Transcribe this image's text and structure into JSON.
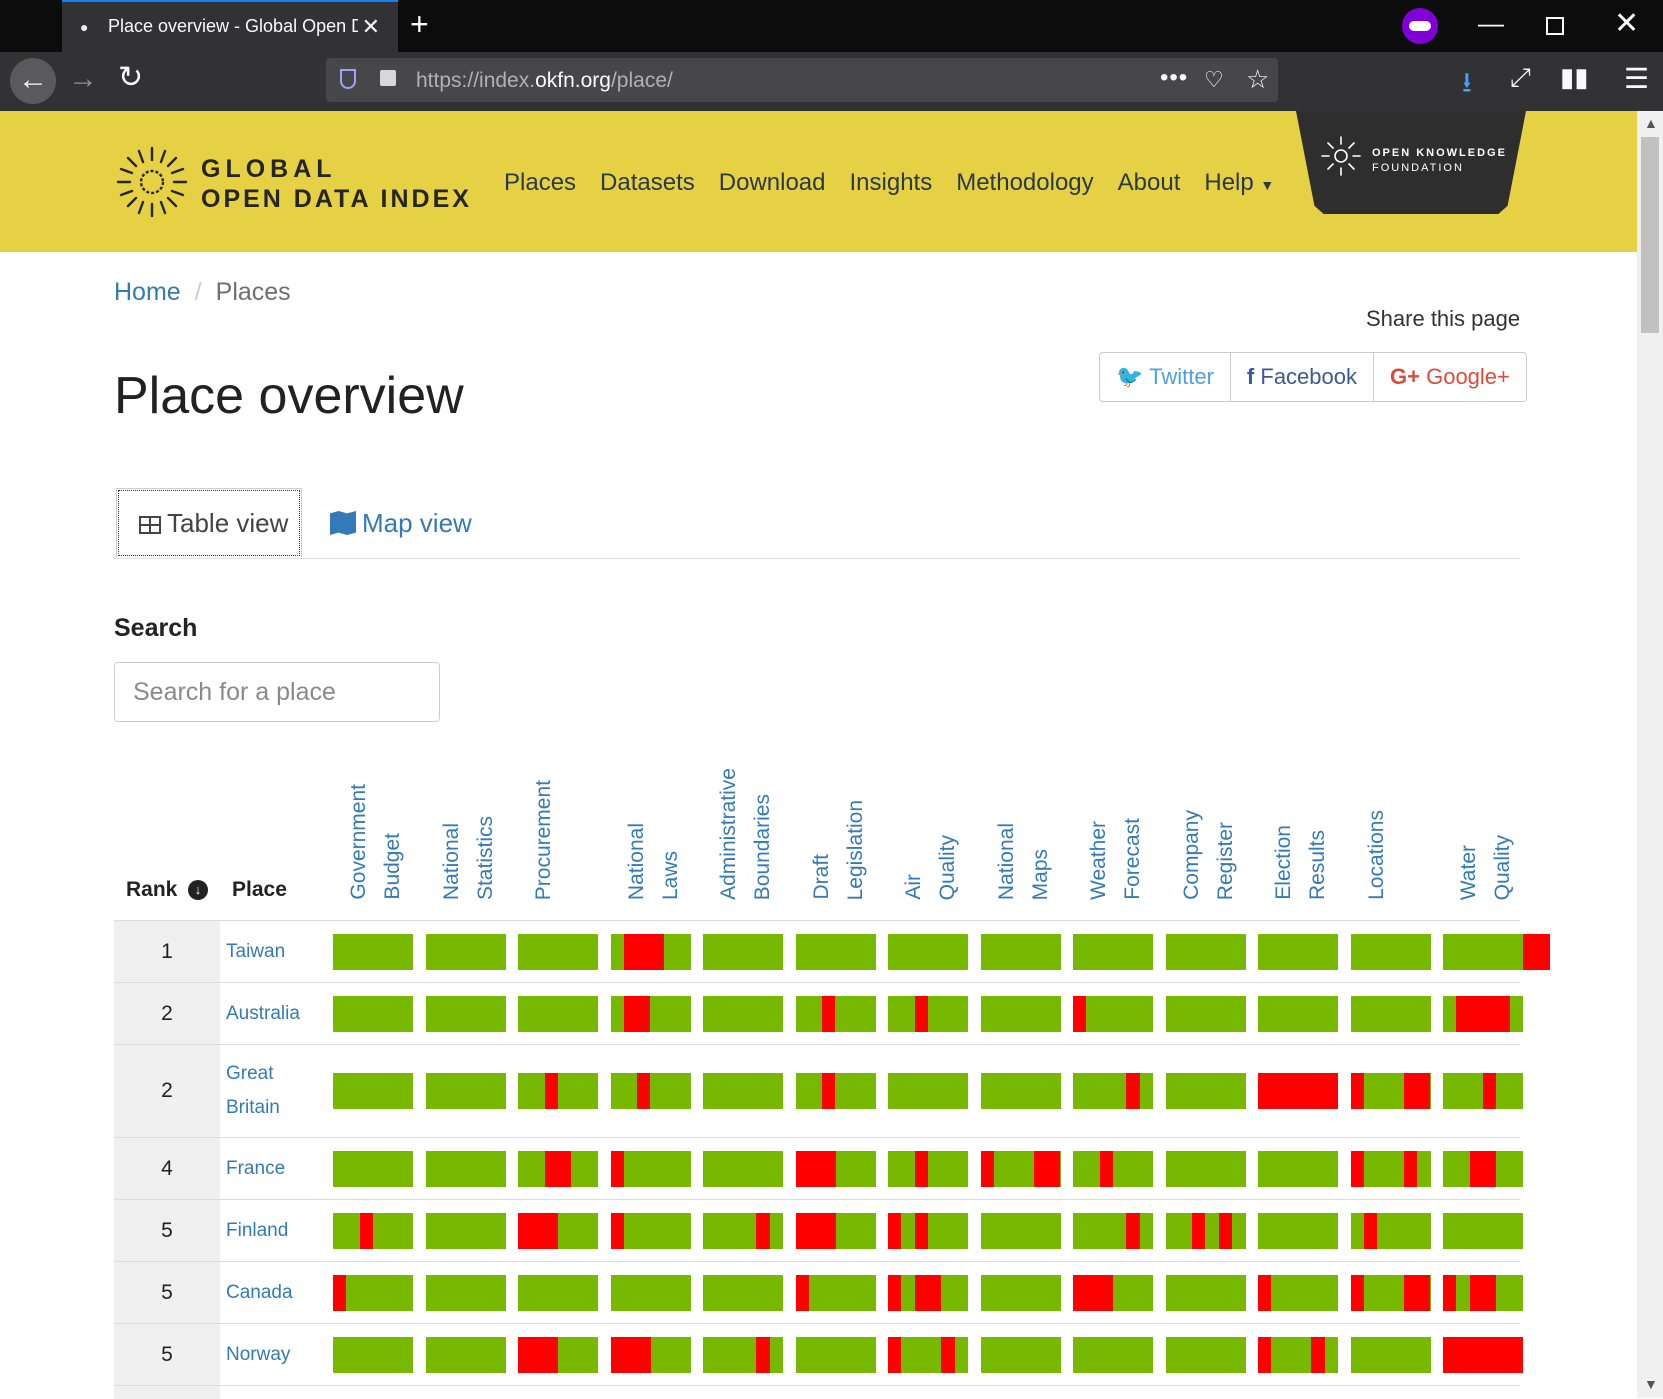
{
  "browser": {
    "tab_title": "Place overview - Global Open D",
    "new_tab": "+",
    "url_prefix": "https://index.",
    "url_domain": "okfn.org",
    "url_path": "/place/"
  },
  "header": {
    "logo_line1": "GLOBAL",
    "logo_line2": "OPEN DATA INDEX",
    "nav": [
      "Places",
      "Datasets",
      "Download",
      "Insights",
      "Methodology",
      "About",
      "Help"
    ],
    "okfn_line1": "OPEN KNOWLEDGE",
    "okfn_line2": "FOUNDATION"
  },
  "breadcrumb": {
    "home": "Home",
    "sep": "/",
    "current": "Places"
  },
  "share": {
    "label": "Share this page",
    "twitter": "Twitter",
    "facebook": "Facebook",
    "google": "Google+"
  },
  "page_title": "Place overview",
  "view_tabs": {
    "table": "Table view",
    "map": "Map view"
  },
  "search": {
    "label": "Search",
    "placeholder": "Search for a place"
  },
  "table": {
    "rank_header": "Rank",
    "place_header": "Place",
    "columns": [
      [
        "Government",
        "Budget"
      ],
      [
        "National",
        "Statistics"
      ],
      [
        "Procurement"
      ],
      [
        "National",
        "Laws"
      ],
      [
        "Administrative",
        "Boundaries"
      ],
      [
        "Draft",
        "Legislation"
      ],
      [
        "Air",
        "Quality"
      ],
      [
        "National",
        "Maps"
      ],
      [
        "Weather",
        "Forecast"
      ],
      [
        "Company",
        "Register"
      ],
      [
        "Election",
        "Results"
      ],
      [
        "Locations"
      ],
      [
        "Water",
        "Quality"
      ]
    ],
    "colors": {
      "open": "#77b800",
      "closed": "#ff0000"
    },
    "rows": [
      {
        "rank": "1",
        "place": [
          "Taiwan"
        ],
        "bars": [
          [],
          [],
          [],
          [
            [
              1,
              4
            ]
          ],
          [],
          [],
          [],
          [],
          [],
          [],
          [],
          [],
          [
            [
              6,
              8
            ]
          ]
        ]
      },
      {
        "rank": "2",
        "place": [
          "Australia"
        ],
        "bars": [
          [],
          [],
          [],
          [
            [
              1,
              3
            ]
          ],
          [],
          [
            [
              2,
              3
            ]
          ],
          [
            [
              2,
              3
            ]
          ],
          [],
          [
            [
              0,
              1
            ]
          ],
          [],
          [],
          [],
          [
            [
              1,
              5
            ]
          ]
        ]
      },
      {
        "rank": "2",
        "place": [
          "Great",
          "Britain"
        ],
        "bars": [
          [],
          [],
          [
            [
              2,
              3
            ]
          ],
          [
            [
              2,
              3
            ]
          ],
          [],
          [
            [
              2,
              3
            ]
          ],
          [],
          [],
          [
            [
              4,
              5
            ]
          ],
          [],
          [
            [
              0,
              6
            ]
          ],
          [
            [
              0,
              1
            ],
            [
              4,
              6
            ]
          ],
          [
            [
              3,
              4
            ]
          ]
        ]
      },
      {
        "rank": "4",
        "place": [
          "France"
        ],
        "bars": [
          [],
          [],
          [
            [
              2,
              4
            ]
          ],
          [
            [
              0,
              1
            ]
          ],
          [],
          [
            [
              0,
              3
            ]
          ],
          [
            [
              2,
              3
            ]
          ],
          [
            [
              0,
              1
            ],
            [
              4,
              6
            ]
          ],
          [
            [
              2,
              3
            ]
          ],
          [],
          [],
          [
            [
              0,
              1
            ],
            [
              4,
              5
            ]
          ],
          [
            [
              2,
              4
            ]
          ]
        ]
      },
      {
        "rank": "5",
        "place": [
          "Finland"
        ],
        "bars": [
          [
            [
              2,
              3
            ]
          ],
          [],
          [
            [
              0,
              3
            ]
          ],
          [
            [
              0,
              1
            ]
          ],
          [
            [
              4,
              5
            ]
          ],
          [
            [
              0,
              3
            ]
          ],
          [
            [
              0,
              1
            ],
            [
              2,
              3
            ]
          ],
          [],
          [
            [
              4,
              5
            ]
          ],
          [
            [
              2,
              3
            ],
            [
              4,
              5
            ]
          ],
          [],
          [
            [
              1,
              2
            ]
          ],
          []
        ]
      },
      {
        "rank": "5",
        "place": [
          "Canada"
        ],
        "bars": [
          [
            [
              0,
              1
            ]
          ],
          [],
          [],
          [],
          [],
          [
            [
              0,
              1
            ]
          ],
          [
            [
              0,
              1
            ],
            [
              2,
              4
            ]
          ],
          [],
          [
            [
              0,
              3
            ]
          ],
          [],
          [
            [
              0,
              1
            ]
          ],
          [
            [
              0,
              1
            ],
            [
              4,
              6
            ]
          ],
          [
            [
              0,
              1
            ],
            [
              2,
              4
            ]
          ]
        ]
      },
      {
        "rank": "5",
        "place": [
          "Norway"
        ],
        "bars": [
          [],
          [],
          [
            [
              0,
              3
            ]
          ],
          [
            [
              0,
              3
            ]
          ],
          [
            [
              4,
              5
            ]
          ],
          [],
          [
            [
              0,
              1
            ],
            [
              4,
              5
            ]
          ],
          [],
          [],
          [],
          [
            [
              0,
              1
            ],
            [
              4,
              5
            ]
          ],
          [],
          [
            [
              0,
              6
            ]
          ]
        ]
      }
    ]
  }
}
